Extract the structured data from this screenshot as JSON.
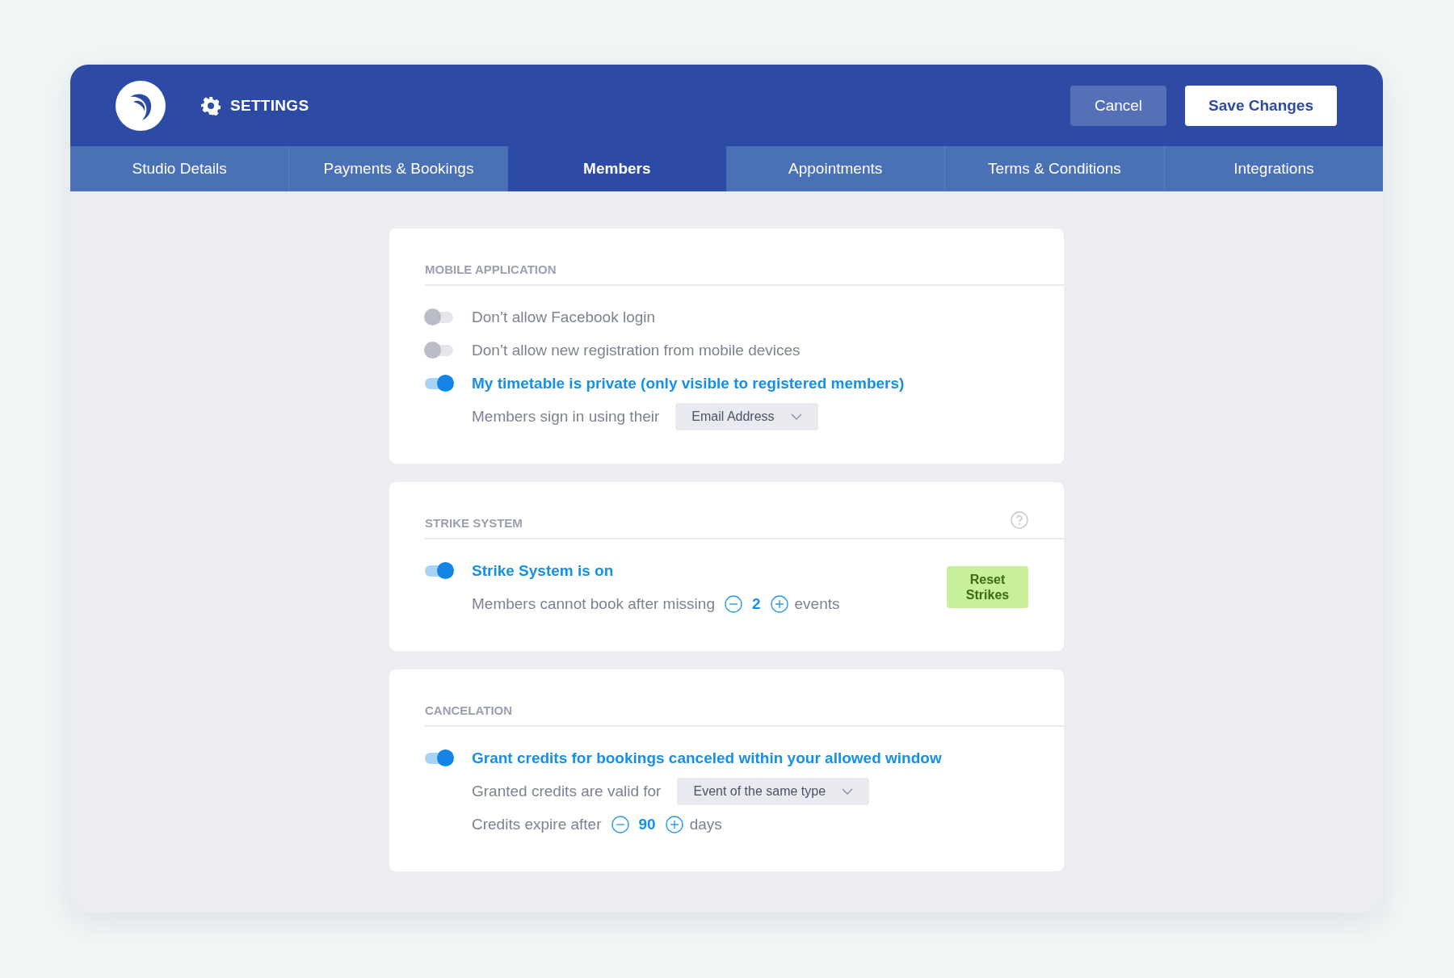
{
  "header": {
    "title": "SETTINGS",
    "buttons": [
      {
        "label": "Cancel",
        "kind": "secondary"
      },
      {
        "label": "Save Changes",
        "kind": "primary"
      }
    ]
  },
  "tabs": [
    {
      "label": "Studio Details",
      "selected": false
    },
    {
      "label": "Payments & Bookings",
      "selected": false
    },
    {
      "label": "Members",
      "selected": true
    },
    {
      "label": "Appointments",
      "selected": false
    },
    {
      "label": "Terms & Conditions",
      "selected": false
    },
    {
      "label": "Integrations",
      "selected": false
    }
  ],
  "sections": [
    {
      "title": "MOBILE APPLICATION",
      "help": false,
      "rows": [
        {
          "kind": "toggle",
          "label": "Don’t allow Facebook login",
          "on": false
        },
        {
          "kind": "toggle",
          "label": "Don’t allow new registration from mobile devices",
          "on": false
        },
        {
          "kind": "toggle",
          "label": "My timetable is private (only visible to registered members)",
          "on": true
        },
        {
          "kind": "select",
          "label": "Members sign in using their",
          "value": "Email Address"
        }
      ]
    },
    {
      "title": "STRIKE SYSTEM",
      "help": true,
      "action": "Reset Strikes",
      "rows": [
        {
          "kind": "toggle",
          "label": "Strike System is on",
          "on": true
        },
        {
          "kind": "stepper",
          "label": "Members cannot book after missing",
          "value": "2",
          "unit": "events"
        }
      ]
    },
    {
      "title": "CANCELATION",
      "help": false,
      "rows": [
        {
          "kind": "toggle",
          "label": "Grant credits for bookings canceled within your allowed window",
          "on": true
        },
        {
          "kind": "select",
          "label": "Granted credits are valid for",
          "value": "Event of the same type"
        },
        {
          "kind": "stepper",
          "label": "Credits expire after",
          "value": "90",
          "unit": "days"
        }
      ]
    }
  ]
}
